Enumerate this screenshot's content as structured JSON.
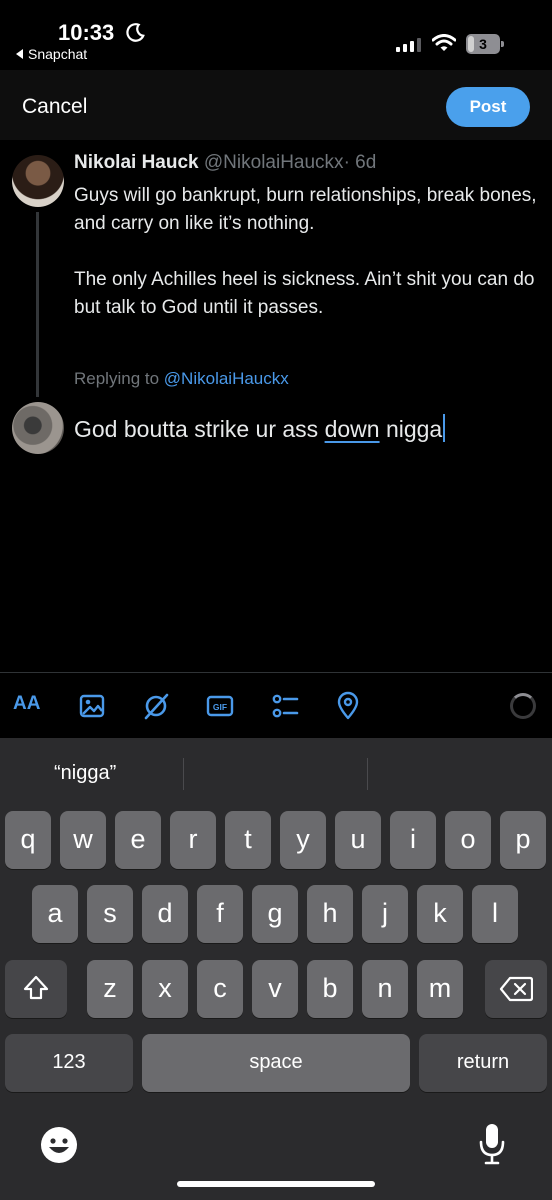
{
  "status_bar": {
    "time": "10:33",
    "back_app": "Snapchat",
    "battery": "3"
  },
  "header": {
    "cancel_label": "Cancel",
    "post_label": "Post"
  },
  "tweet": {
    "author_name": "Nikolai Hauck",
    "author_handle": "@NikolaiHauckx",
    "age": "· 6d",
    "paragraphs": [
      "Guys will go bankrupt, burn relationships, break bones, and carry on like it’s nothing.",
      "The only Achilles heel is sickness. Ain’t shit you can do but talk to God until it passes."
    ]
  },
  "reply": {
    "replying_to_label": "Replying to",
    "replying_to_handle": "@NikolaiHauckx",
    "text_before": "God boutta strike ur ass ",
    "text_underlined": "down",
    "text_after": " nigga"
  },
  "toolbar": {
    "text_style_label": "AA",
    "gif_label": "GIF"
  },
  "keyboard": {
    "suggestions": [
      "“nigga”",
      "",
      ""
    ],
    "row1": [
      "q",
      "w",
      "e",
      "r",
      "t",
      "y",
      "u",
      "i",
      "o",
      "p"
    ],
    "row2": [
      "a",
      "s",
      "d",
      "f",
      "g",
      "h",
      "j",
      "k",
      "l"
    ],
    "row3": [
      "z",
      "x",
      "c",
      "v",
      "b",
      "n",
      "m"
    ],
    "numbers_label": "123",
    "space_label": "space",
    "return_label": "return"
  },
  "colors": {
    "accent": "#4a99e9",
    "post_button": "#4aa0ec",
    "background": "#000000",
    "muted_text": "#71767b",
    "keyboard_bg": "#2b2b2d",
    "key_bg": "#6b6b6e",
    "key_dark_bg": "#464649"
  }
}
